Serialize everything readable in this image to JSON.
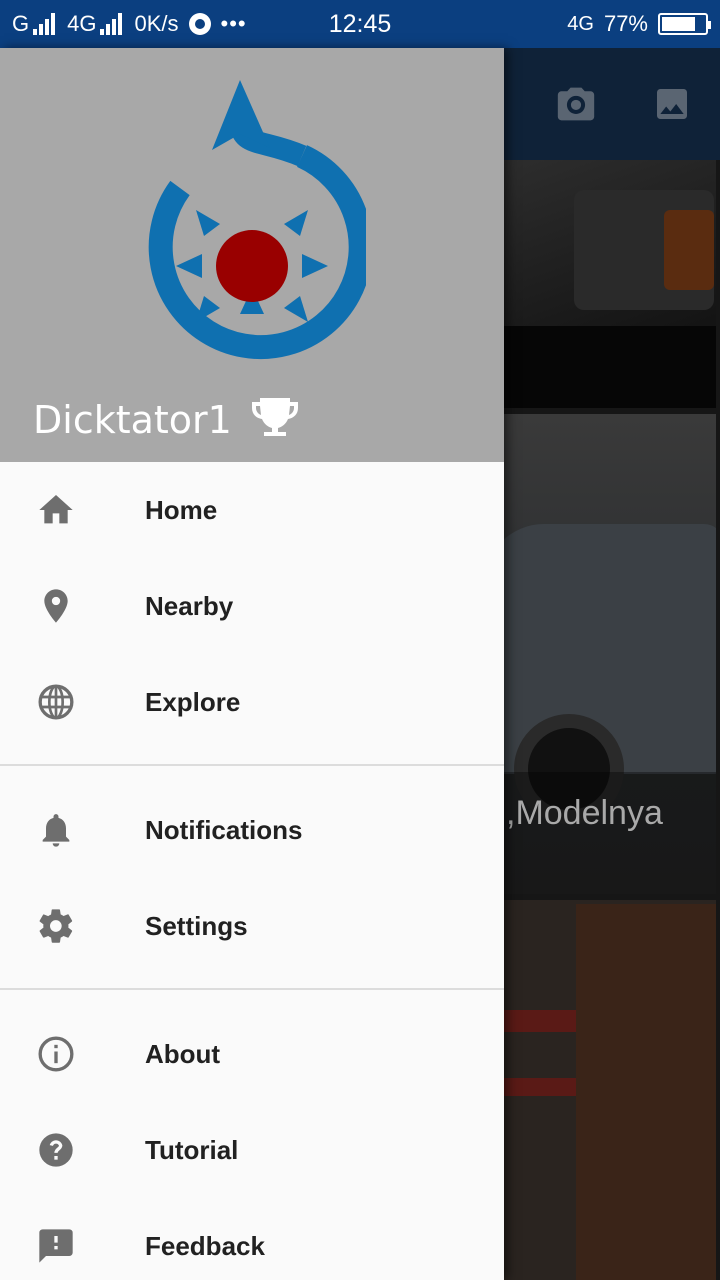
{
  "status_bar": {
    "carrier1": "G",
    "carrier2": "4G",
    "speed": "0K/s",
    "overflow": "•••",
    "time": "12:45",
    "network_right": "4G",
    "battery": "77%"
  },
  "background": {
    "toolbar_icons": [
      "camera-icon",
      "image-icon"
    ],
    "caption_text": ",Modelnya"
  },
  "drawer": {
    "username": "Dicktator1",
    "logo": "wikimedia-commons-logo",
    "menu_groups": [
      [
        {
          "label": "Home",
          "icon": "home-icon"
        },
        {
          "label": "Nearby",
          "icon": "location-pin-icon"
        },
        {
          "label": "Explore",
          "icon": "globe-icon"
        }
      ],
      [
        {
          "label": "Notifications",
          "icon": "bell-icon"
        },
        {
          "label": "Settings",
          "icon": "gear-icon"
        }
      ],
      [
        {
          "label": "About",
          "icon": "info-icon"
        },
        {
          "label": "Tutorial",
          "icon": "help-icon"
        },
        {
          "label": "Feedback",
          "icon": "feedback-icon"
        }
      ]
    ]
  },
  "colors": {
    "status_bar": "#0b3f80",
    "header_bg": "#a8a8a8",
    "logo_blue": "#0f70b0",
    "logo_red": "#990000",
    "icon_gray": "#6e6e6e",
    "label": "#212121"
  }
}
